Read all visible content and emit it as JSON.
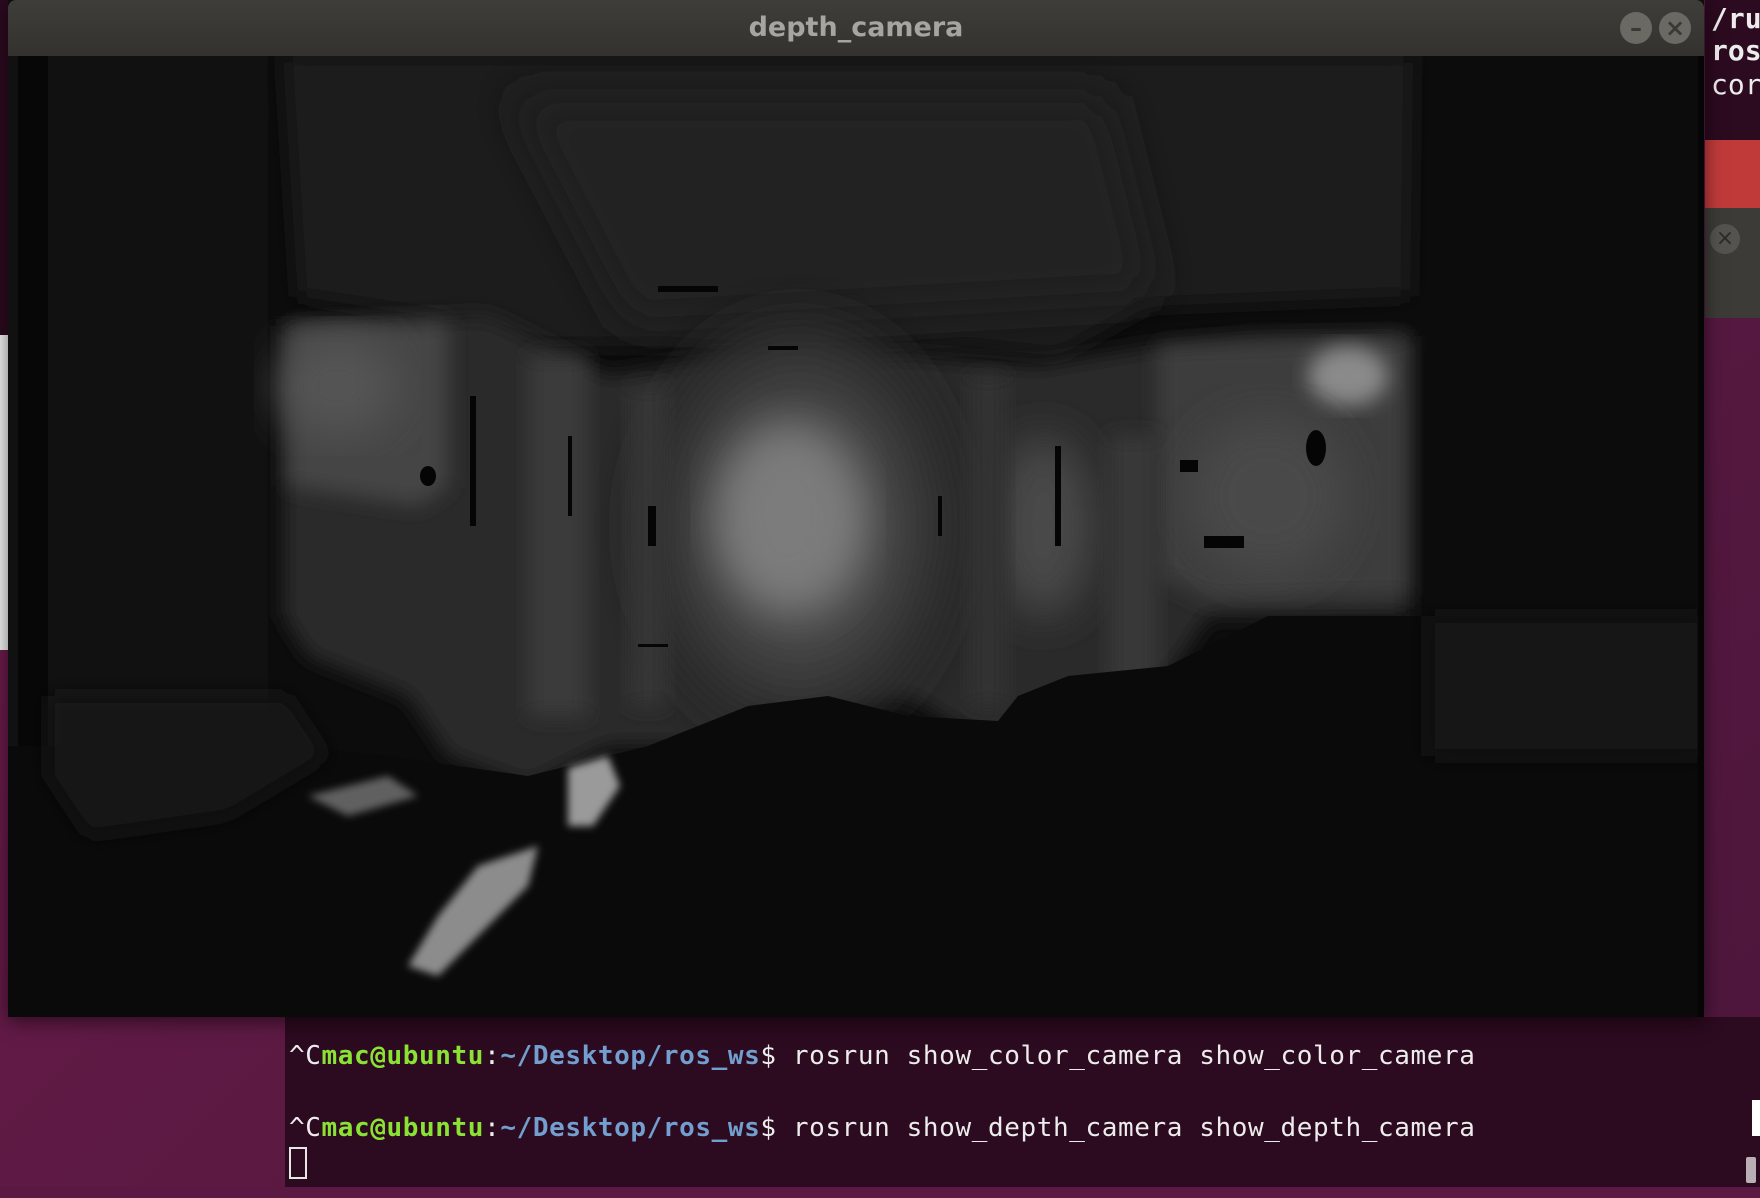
{
  "window": {
    "title": "depth_camera",
    "minimize_icon": "minimize-icon",
    "close_icon": "close-icon"
  },
  "terminal": {
    "lines": [
      {
        "prefix": "^C",
        "user": "mac@ubuntu",
        "separator": ":",
        "path": "~/Desktop/ros_ws",
        "dollar": "$ ",
        "command": "rosrun show_color_camera show_color_camera"
      },
      {
        "prefix": "^C",
        "user": "mac@ubuntu",
        "separator": ":",
        "path": "~/Desktop/ros_ws",
        "dollar": "$ ",
        "command": "rosrun show_depth_camera show_depth_camera"
      }
    ]
  },
  "right_terminal": {
    "lines": [
      "/ru",
      "ros",
      "cor"
    ]
  },
  "colors": {
    "prompt_user": "#8ae234",
    "prompt_path": "#729fcf",
    "terminal_bg": "#2c0a1f",
    "titlebar": "#3c3b37"
  }
}
